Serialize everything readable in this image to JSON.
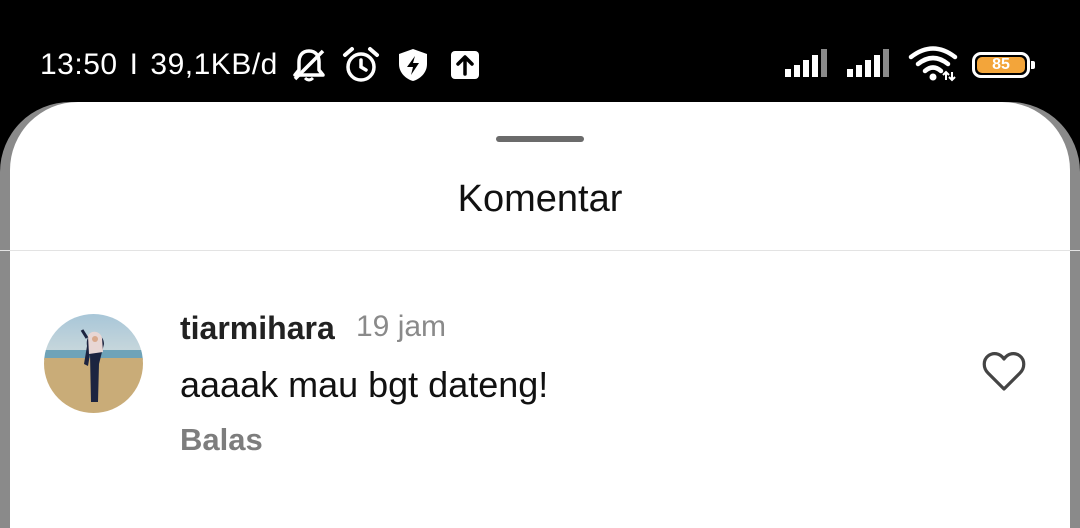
{
  "status_bar": {
    "time": "13:50",
    "separator": "I",
    "network_speed": "39,1KB/d",
    "icons_left": [
      "bell-off-icon",
      "alarm-icon",
      "shield-bolt-icon",
      "upload-icon"
    ],
    "icons_right": [
      "signal-icon",
      "signal-icon",
      "wifi-icon"
    ],
    "battery_level": "85",
    "battery_color": "#f3a53a"
  },
  "sheet": {
    "title": "Komentar"
  },
  "comments": [
    {
      "username": "tiarmihara",
      "time_ago": "19 jam",
      "text": "aaaak mau bgt dateng!",
      "reply_label": "Balas"
    }
  ]
}
